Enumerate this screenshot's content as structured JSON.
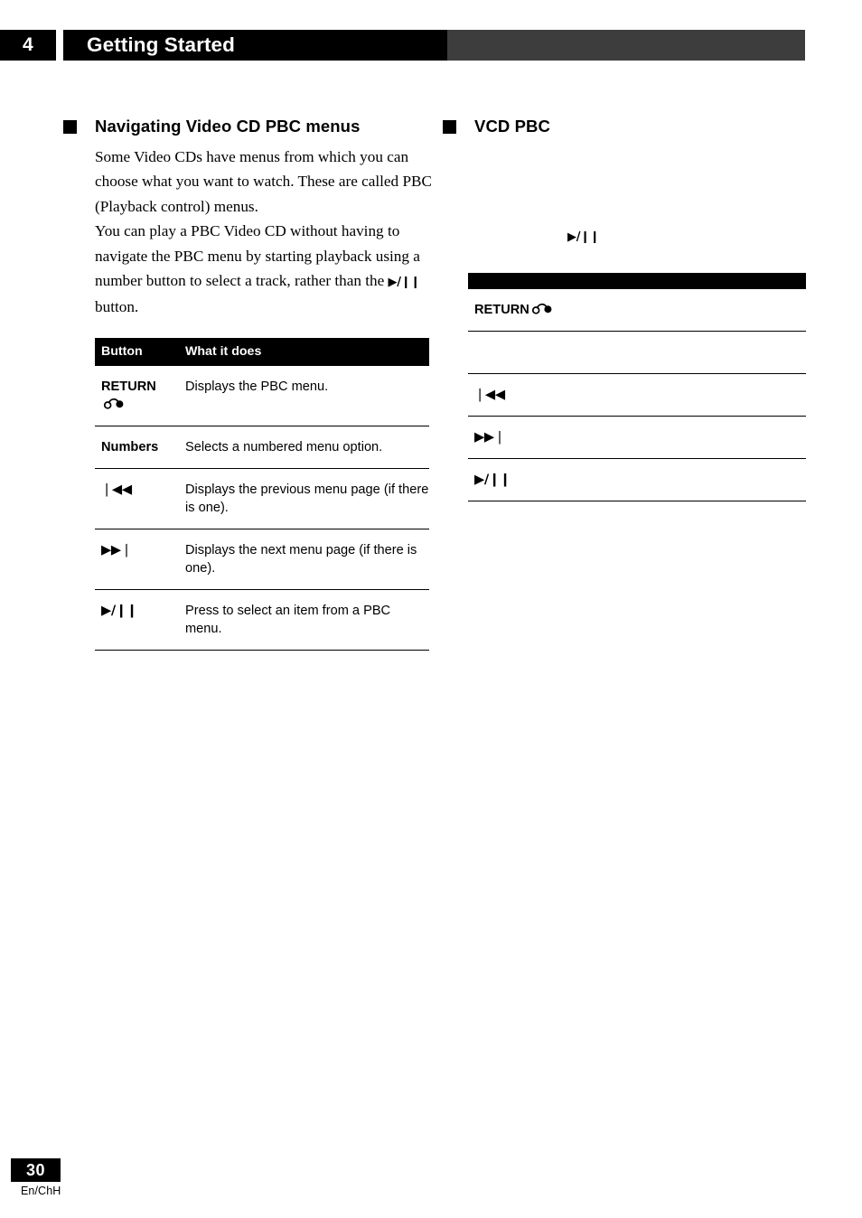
{
  "header": {
    "chapter_number": "4",
    "chapter_title": "Getting Started",
    "chapter_title_translated": ""
  },
  "left_column": {
    "section_heading": "Navigating Video CD PBC menus",
    "paragraph_1": "Some Video CDs have menus from which you can choose what you want to watch. These are called PBC (Playback control) menus.",
    "paragraph_2_part1": "You can play a PBC Video CD without having to navigate the PBC menu by starting playback using a number button to select a track, rather than the ",
    "paragraph_2_symbol": "▶/❙❙",
    "paragraph_2_part2": " button.",
    "table": {
      "headers": [
        "Button",
        "What it does"
      ],
      "rows": [
        {
          "button": "RETURN",
          "has_return_glyph": true,
          "does": "Displays the PBC menu."
        },
        {
          "button": "Numbers",
          "has_return_glyph": false,
          "does": "Selects a numbered menu option."
        },
        {
          "button": "❘◀◀",
          "has_return_glyph": false,
          "does": "Displays the previous menu page (if there is one)."
        },
        {
          "button": "▶▶❘",
          "has_return_glyph": false,
          "does": "Displays the next menu page (if there is one)."
        },
        {
          "button": "▶/❙❙",
          "has_return_glyph": false,
          "does": "Press to select an item from a PBC menu."
        }
      ]
    }
  },
  "right_column": {
    "section_heading": "VCD PBC",
    "paragraph_1": "",
    "paragraph_2": "",
    "inline_symbol": "▶/❙❙",
    "table": {
      "header_label": "",
      "rows": [
        {
          "button": "RETURN",
          "has_return_glyph": true,
          "does": ""
        },
        {
          "button": "",
          "has_return_glyph": false,
          "does": ""
        },
        {
          "button": "❘◀◀",
          "has_return_glyph": false,
          "does": ""
        },
        {
          "button": "▶▶❘",
          "has_return_glyph": false,
          "does": ""
        },
        {
          "button": "▶/❙❙",
          "has_return_glyph": false,
          "does": ""
        }
      ]
    }
  },
  "footer": {
    "page_number": "30",
    "language_code": "En/ChH"
  },
  "colors": {
    "header_black": "#000000",
    "header_grey": "#3d3d3d",
    "text": "#000000",
    "page_background": "#ffffff"
  }
}
